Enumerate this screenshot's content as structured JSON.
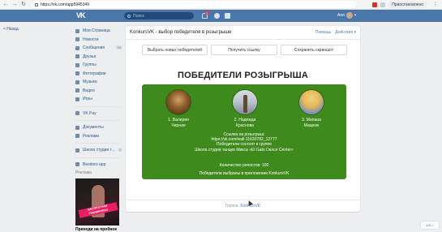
{
  "browser": {
    "url": "https://vk.com/app5945349",
    "profile_label": "Приостановлено"
  },
  "vk_header": {
    "logo": "VK",
    "search_placeholder": "Поиск",
    "notification_count": "1",
    "user_name": "Аня"
  },
  "back_link": "< Назад",
  "leftnav": {
    "items": [
      {
        "label": "Моя Страница",
        "icon": "home-icon"
      },
      {
        "label": "Новости",
        "icon": "news-icon"
      },
      {
        "label": "Сообщения",
        "icon": "messages-icon",
        "badge": "19"
      },
      {
        "label": "Друзья",
        "icon": "friends-icon"
      },
      {
        "label": "Группы",
        "icon": "groups-icon"
      },
      {
        "label": "Фотографии",
        "icon": "photos-icon"
      },
      {
        "label": "Музыка",
        "icon": "music-icon"
      },
      {
        "label": "Видео",
        "icon": "video-icon"
      },
      {
        "label": "Игры",
        "icon": "games-icon"
      }
    ],
    "items2": [
      {
        "label": "VK Pay",
        "icon": "vkpay-icon"
      }
    ],
    "items3": [
      {
        "label": "Документы",
        "icon": "docs-icon"
      },
      {
        "label": "Реклама",
        "icon": "ads-icon"
      }
    ],
    "items4": [
      {
        "label": "Школа студии т...",
        "icon": "school-icon",
        "badge": "1"
      }
    ],
    "items5": [
      {
        "label": "Besdoro app",
        "icon": "app-icon"
      }
    ],
    "ads_label": "Реклама",
    "ad_banner_text": "БЕСПЛАТНАЯ ТРЕНИРОВКА",
    "ad_caption": "Приходи на пробное"
  },
  "app": {
    "title": "KonkursVK - выбор победителя в розыгрыше",
    "help_link": "Помощь",
    "actions_link": "Действия",
    "buttons": {
      "pick_new": "Выбрать новых победителей",
      "get_link": "Получить ссылку",
      "save_screenshot": "Сохранить скриншот"
    },
    "winners_title": "ПОБЕДИТЕЛИ РОЗЫГРЫША",
    "winners": [
      {
        "line1": "1. Валерия",
        "line2": "Черная"
      },
      {
        "line1": "2. Надежда",
        "line2": "Краснова"
      },
      {
        "line1": "3. Милана",
        "line2": "Мацеюк"
      }
    ],
    "info": {
      "line1": "Ссылка на розыгрыш:",
      "line2": "https://vk.com/wall-11630782_12777",
      "line3": "Победители состоят в группе",
      "line4": "Школа студии танцев Микса «El Gato Dance Center»"
    },
    "reposts": "Количество репостов: 100",
    "chosen_in": "Победители выбраны в приложении KonkursVK",
    "footer_label": "Группа:",
    "footer_group": "KonkursVK"
  },
  "chat_tab": "1/3 ⌂",
  "colors": {
    "vk_blue": "#4a76a8",
    "panel_green": "#3f8a1c",
    "link": "#2a5885"
  }
}
